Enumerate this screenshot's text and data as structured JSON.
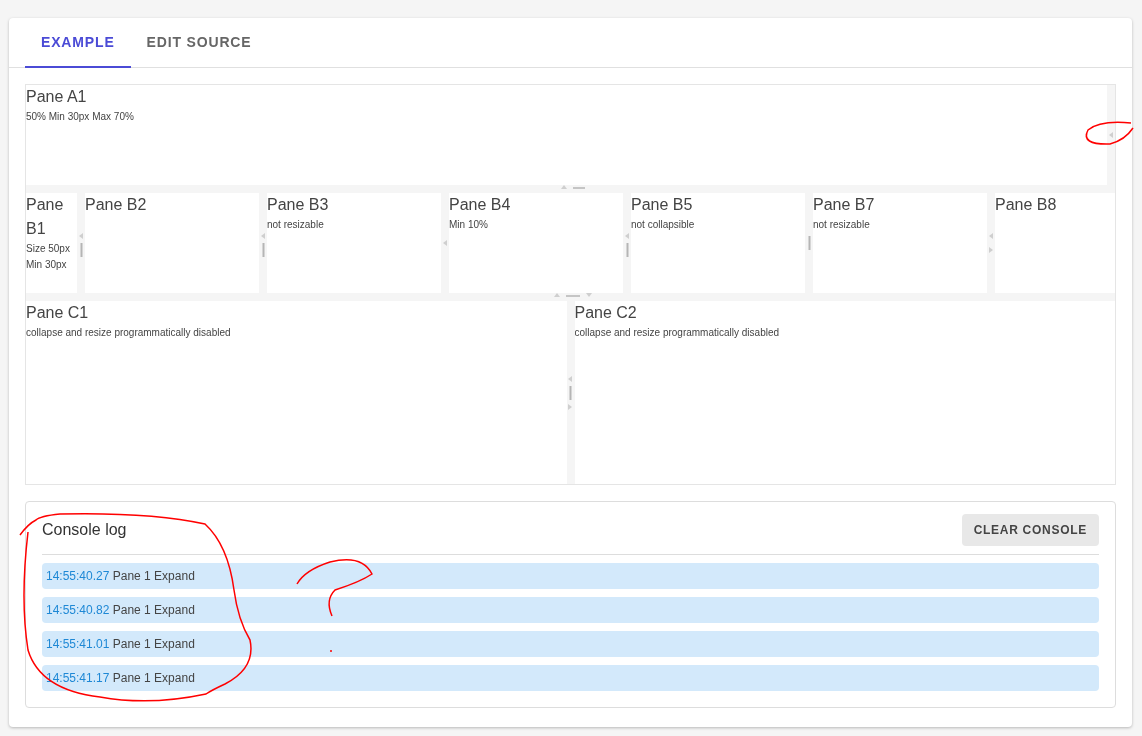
{
  "tabs": [
    {
      "label": "EXAMPLE",
      "selected": true
    },
    {
      "label": "EDIT SOURCE",
      "selected": false
    }
  ],
  "pane_a": [
    {
      "title": "Pane A1",
      "note": "50% Min 30px Max 70%"
    }
  ],
  "pane_b": [
    {
      "title": "Pane B1",
      "note": "Size 50px Min 30px"
    },
    {
      "title": "Pane B2"
    },
    {
      "title": "Pane B3",
      "note": "not resizable"
    },
    {
      "title": "Pane B4",
      "note": "Min 10%"
    },
    {
      "title": "Pane B5",
      "note": "not collapsible"
    },
    {
      "title": "Pane B7",
      "note": "not resizable"
    },
    {
      "title": "Pane B8"
    }
  ],
  "pane_c": [
    {
      "title": "Pane C1",
      "note": "collapse and resize programmatically disabled"
    },
    {
      "title": "Pane C2",
      "note": "collapse and resize programmatically disabled"
    }
  ],
  "console": {
    "title": "Console log",
    "clear_button": "CLEAR CONSOLE",
    "entries": [
      {
        "time": "14:55:40.27",
        "message": "Pane 1 Expand"
      },
      {
        "time": "14:55:40.82",
        "message": "Pane 1 Expand"
      },
      {
        "time": "14:55:41.01",
        "message": "Pane 1 Expand"
      },
      {
        "time": "14:55:41.17",
        "message": "Pane 1 Expand"
      }
    ]
  }
}
